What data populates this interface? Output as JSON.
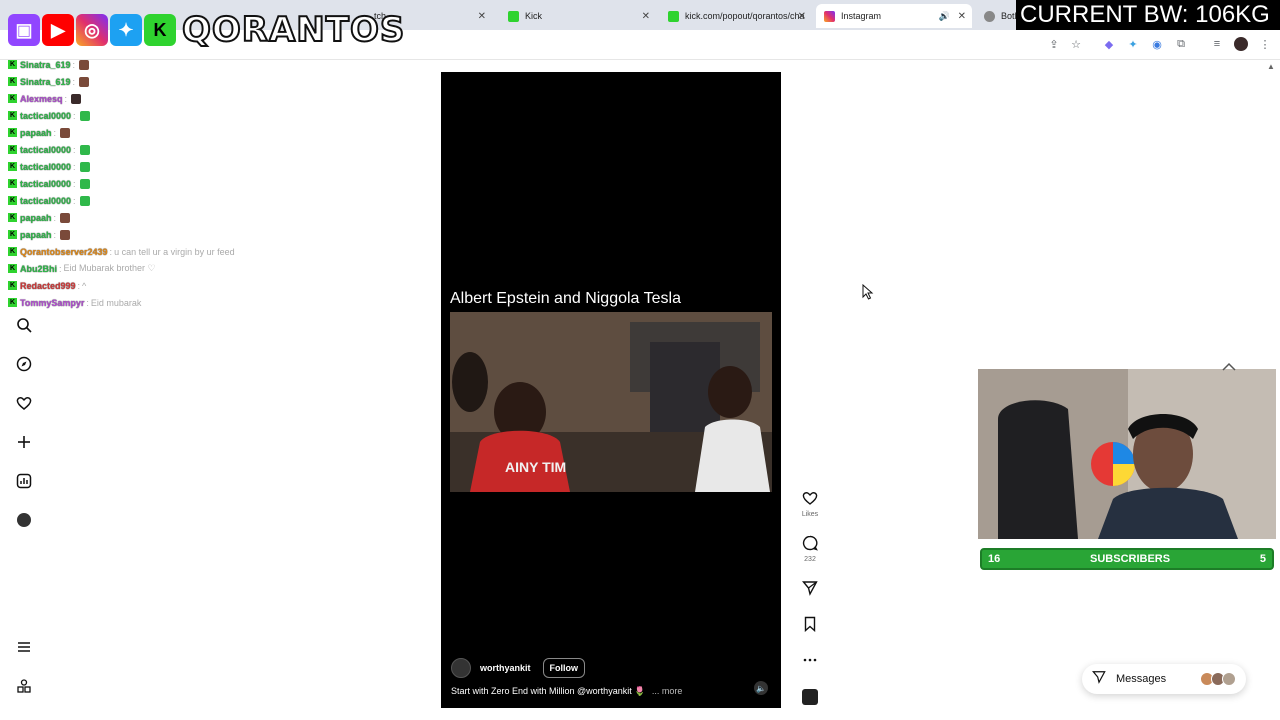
{
  "browser": {
    "tabs": [
      {
        "label": "tch",
        "active": false
      },
      {
        "label": "Kick",
        "active": false
      },
      {
        "label": "kick.com/popout/qorantos/cha",
        "active": false
      },
      {
        "label": "Instagram",
        "active": true
      },
      {
        "label": "BotR",
        "active": false
      }
    ]
  },
  "overlay": {
    "brand": "QORANTOS",
    "bw_label": "CURRENT BW: 106KG",
    "social_icons": [
      "twitch-icon",
      "youtube-icon",
      "instagram-icon",
      "twitter-icon",
      "kick-icon"
    ]
  },
  "chat": [
    {
      "user": "Sinatra_619",
      "sep": ":",
      "msg": "",
      "color": "#2fb84a"
    },
    {
      "user": "Sinatra_619",
      "sep": ":",
      "msg": "",
      "color": "#2fb84a"
    },
    {
      "user": "Alexmesq",
      "sep": ":",
      "msg": "",
      "color": "#b04fd0"
    },
    {
      "user": "tactical0000",
      "sep": ":",
      "msg": "",
      "color": "#2fb84a"
    },
    {
      "user": "papaah",
      "sep": ":",
      "msg": "",
      "color": "#2fb84a"
    },
    {
      "user": "tactical0000",
      "sep": ":",
      "msg": "",
      "color": "#2fb84a"
    },
    {
      "user": "tactical0000",
      "sep": ":",
      "msg": "",
      "color": "#2fb84a"
    },
    {
      "user": "tactical0000",
      "sep": ":",
      "msg": "",
      "color": "#2fb84a"
    },
    {
      "user": "tactical0000",
      "sep": ":",
      "msg": "",
      "color": "#2fb84a"
    },
    {
      "user": "papaah",
      "sep": ":",
      "msg": "",
      "color": "#2fb84a"
    },
    {
      "user": "papaah",
      "sep": ":",
      "msg": "",
      "color": "#2fb84a"
    },
    {
      "user": "Qorantobserver2439",
      "sep": ":",
      "msg": "u can tell ur a virgin by ur feed",
      "color": "#e08a1a"
    },
    {
      "user": "Abu2Bhi",
      "sep": ":",
      "msg": "Eid Mubarak brother ♡",
      "color": "#2fb84a"
    },
    {
      "user": "Redacted999",
      "sep": ":",
      "msg": "^",
      "color": "#d03a3a"
    },
    {
      "user": "TommySampyr",
      "sep": ":",
      "msg": "Eid mubarak",
      "color": "#b04fd0"
    }
  ],
  "reel": {
    "caption_title": "Albert Epstein and Niggola Tesla",
    "username": "worthyankit",
    "follow_label": "Follow",
    "description": "Start with Zero End with Million @worthyankit 🌷",
    "more_label": "... more",
    "likes_label": "Likes",
    "comments_count": "232"
  },
  "webcam": {
    "subs_left": "16",
    "subs_label": "SUBSCRIBERS",
    "subs_right": "5"
  },
  "messages": {
    "label": "Messages"
  }
}
